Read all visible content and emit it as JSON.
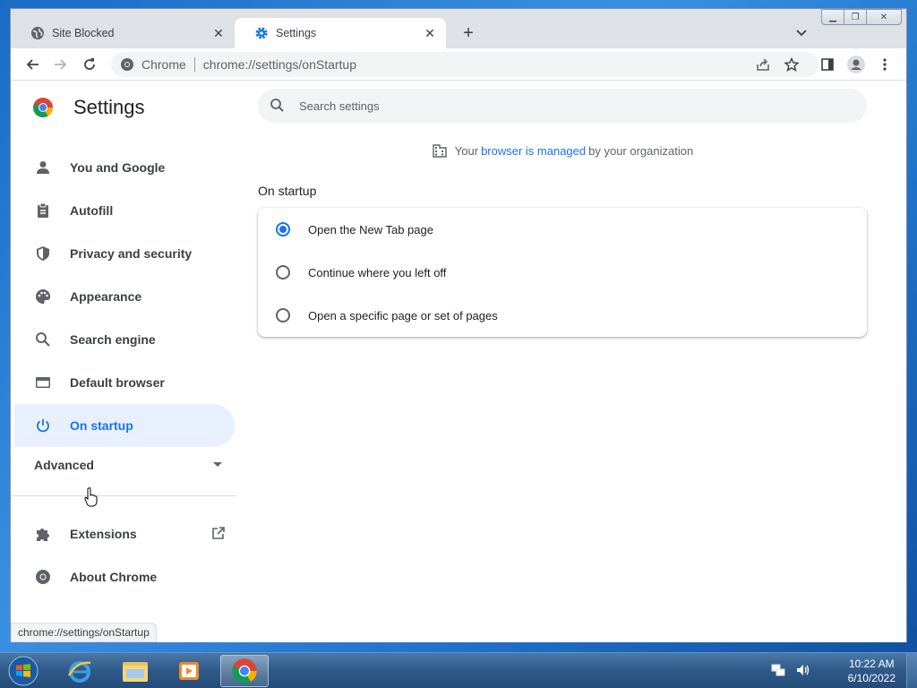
{
  "browser": {
    "tabs": [
      {
        "title": "Site Blocked",
        "favicon": "globe-icon",
        "active": false
      },
      {
        "title": "Settings",
        "favicon": "gear-icon",
        "active": true
      }
    ],
    "new_tab_symbol": "+",
    "omnibox": {
      "site_label": "Chrome",
      "url": "chrome://settings/onStartup"
    }
  },
  "settings": {
    "title": "Settings",
    "search_placeholder": "Search settings",
    "managed_notice": {
      "prefix": "Your",
      "link": "browser is managed",
      "suffix": "by your organization"
    },
    "nav": [
      {
        "label": "You and Google",
        "icon": "person-icon"
      },
      {
        "label": "Autofill",
        "icon": "clipboard-icon"
      },
      {
        "label": "Privacy and security",
        "icon": "shield-icon"
      },
      {
        "label": "Appearance",
        "icon": "palette-icon"
      },
      {
        "label": "Search engine",
        "icon": "search-icon"
      },
      {
        "label": "Default browser",
        "icon": "browser-window-icon"
      },
      {
        "label": "On startup",
        "icon": "power-icon",
        "active": true
      }
    ],
    "advanced_label": "Advanced",
    "extensions_label": "Extensions",
    "about_label": "About Chrome",
    "section_title": "On startup",
    "startup_options": [
      {
        "label": "Open the New Tab page",
        "selected": true
      },
      {
        "label": "Continue where you left off",
        "selected": false
      },
      {
        "label": "Open a specific page or set of pages",
        "selected": false
      }
    ],
    "status_url": "chrome://settings/onStartup"
  },
  "taskbar": {
    "time": "10:22 AM",
    "date": "6/10/2022",
    "apps": [
      "internet-explorer-icon",
      "file-explorer-icon",
      "media-player-icon",
      "chrome-icon"
    ]
  },
  "colors": {
    "accent": "#1a73e8",
    "active_nav_bg": "#e8f0fe"
  }
}
